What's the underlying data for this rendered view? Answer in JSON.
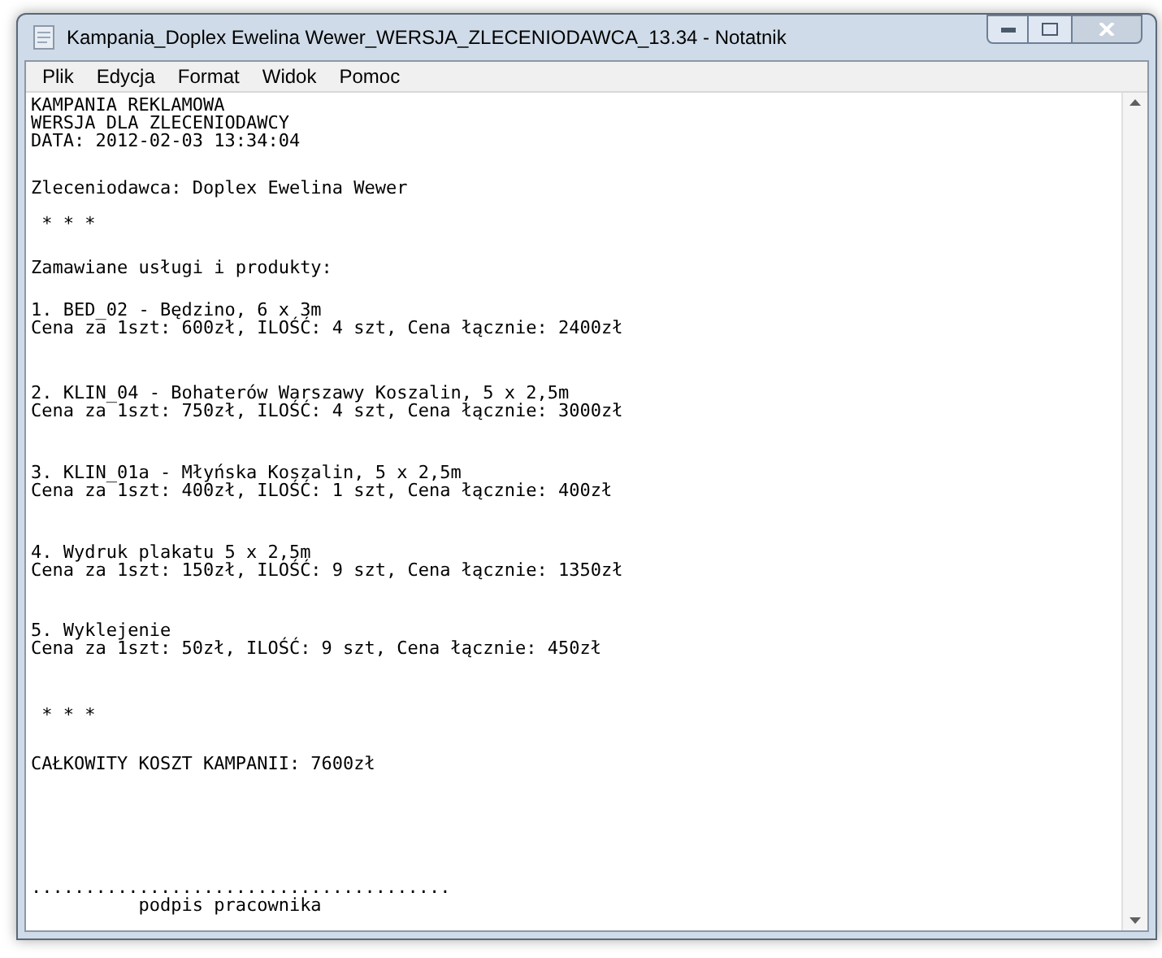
{
  "window": {
    "title": "Kampania_Doplex Ewelina Wewer_WERSJA_ZLECENIODAWCA_13.34 - Notatnik"
  },
  "menu": [
    "Plik",
    "Edycja",
    "Format",
    "Widok",
    "Pomoc"
  ],
  "document": [
    {
      "lines": [
        "KAMPANIA REKLAMOWA",
        "WERSJA DLA ZLECENIODAWCY",
        "DATA: 2012-02-03 13:34:04"
      ]
    },
    {
      "lines": [
        "Zleceniodawca: Doplex Ewelina Wewer"
      ]
    },
    {
      "lines": [
        " * * *"
      ]
    },
    {
      "lines": [
        "Zamawiane usługi i produkty:"
      ]
    },
    {
      "lines": [
        "1. BED_02 - Będzino, 6 x 3m",
        "Cena za 1szt: 600zł, ILOŚĆ: 4 szt, Cena łącznie: 2400zł"
      ]
    },
    {
      "lines": [
        "2. KLIN_04 - Bohaterów Warszawy Koszalin, 5 x 2,5m",
        "Cena za 1szt: 750zł, ILOŚĆ: 4 szt, Cena łącznie: 3000zł"
      ]
    },
    {
      "lines": [
        "3. KLIN_01a - Młyńska Koszalin, 5 x 2,5m",
        "Cena za 1szt: 400zł, ILOŚĆ: 1 szt, Cena łącznie: 400zł"
      ]
    },
    {
      "lines": [
        "4. Wydruk plakatu 5 x 2,5m",
        "Cena za 1szt: 150zł, ILOŚĆ: 9 szt, Cena łącznie: 1350zł"
      ]
    },
    {
      "lines": [
        "5. Wyklejenie",
        "Cena za 1szt: 50zł, ILOŚĆ: 9 szt, Cena łącznie: 450zł"
      ]
    },
    {
      "lines": [
        " * * *"
      ]
    },
    {
      "lines": [
        "CAŁKOWITY KOSZT KAMPANII: 7600zł"
      ]
    },
    {
      "lines": [
        ".......................................",
        "          podpis pracownika"
      ]
    }
  ]
}
